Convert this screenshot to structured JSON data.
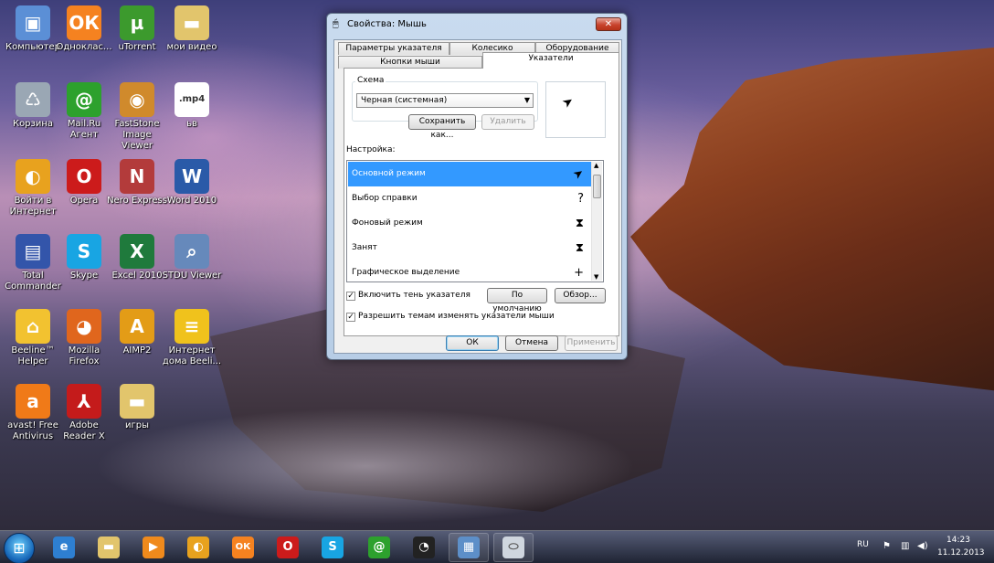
{
  "desktop": {
    "icons": [
      {
        "label": "Компьютер",
        "icon": "computer-icon",
        "color": "#5b8fd6",
        "glyph": "▣"
      },
      {
        "label": "Одноклас...",
        "icon": "odnoklassniki-icon",
        "color": "#f58220",
        "glyph": "ОК"
      },
      {
        "label": "uTorrent",
        "icon": "utorrent-icon",
        "color": "#3c9a2d",
        "glyph": "µ"
      },
      {
        "label": "мои видео",
        "icon": "folder-icon",
        "color": "#e2c56c",
        "glyph": "▬"
      },
      {
        "label": "Корзина",
        "icon": "recycle-bin-icon",
        "color": "#9aa7b4",
        "glyph": "♺"
      },
      {
        "label": "Mail.Ru Агент",
        "icon": "mailru-agent-icon",
        "color": "#2da12d",
        "glyph": "@"
      },
      {
        "label": "FastStone Image Viewer",
        "icon": "faststone-icon",
        "color": "#d08a2c",
        "glyph": "◉"
      },
      {
        "label": "ьв",
        "icon": "mp4-file-icon",
        "color": "#ffffff",
        "glyph": ".mp4"
      },
      {
        "label": "Войти в Интернет",
        "icon": "internet-icon",
        "color": "#e8a21e",
        "glyph": "◐"
      },
      {
        "label": "Opera",
        "icon": "opera-icon",
        "color": "#cc1b1b",
        "glyph": "O"
      },
      {
        "label": "Nero Express",
        "icon": "nero-icon",
        "color": "#b33b3b",
        "glyph": "N"
      },
      {
        "label": "Word 2010",
        "icon": "word-icon",
        "color": "#2a5aa8",
        "glyph": "W"
      },
      {
        "label": "Total Commander",
        "icon": "total-commander-icon",
        "color": "#3355aa",
        "glyph": "▤"
      },
      {
        "label": "Skype",
        "icon": "skype-icon",
        "color": "#18a5e3",
        "glyph": "S"
      },
      {
        "label": "Excel 2010",
        "icon": "excel-icon",
        "color": "#1f7a3c",
        "glyph": "X"
      },
      {
        "label": "STDU Viewer",
        "icon": "stdu-viewer-icon",
        "color": "#6689bb",
        "glyph": "⌕"
      },
      {
        "label": "Beeline™ Helper",
        "icon": "beeline-helper-icon",
        "color": "#f2c230",
        "glyph": "⌂"
      },
      {
        "label": "Mozilla Firefox",
        "icon": "firefox-icon",
        "color": "#e0661d",
        "glyph": "◕"
      },
      {
        "label": "AIMP2",
        "icon": "aimp-icon",
        "color": "#e39c17",
        "glyph": "A"
      },
      {
        "label": "Интернет дома Beeli...",
        "icon": "beeline-icon",
        "color": "#f0c21c",
        "glyph": "≡"
      },
      {
        "label": "avast! Free Antivirus",
        "icon": "avast-icon",
        "color": "#f07a18",
        "glyph": "a"
      },
      {
        "label": "Adobe Reader X",
        "icon": "adobe-reader-icon",
        "color": "#c41b1b",
        "glyph": "⅄"
      },
      {
        "label": "игры",
        "icon": "folder-icon",
        "color": "#e2c56c",
        "glyph": "▬"
      }
    ]
  },
  "dialog": {
    "title": "Свойства: Мышь",
    "close_label": "✕",
    "tabs_row1": [
      "Параметры указателя",
      "Колесико",
      "Оборудование"
    ],
    "tabs_row2": [
      "Кнопки мыши",
      "Указатели"
    ],
    "active_tab": "Указатели",
    "scheme_group_label": "Схема",
    "scheme_value": "Черная (системная)",
    "save_as_label": "Сохранить как...",
    "delete_label": "Удалить",
    "settings_label": "Настройка:",
    "pointer_rows": [
      {
        "label": "Основной режим",
        "cursor": "arrow-cursor-icon",
        "glyph": "➤",
        "selected": true
      },
      {
        "label": "Выбор справки",
        "cursor": "help-cursor-icon",
        "glyph": "?",
        "selected": false
      },
      {
        "label": "Фоновый режим",
        "cursor": "working-cursor-icon",
        "glyph": "⧗",
        "selected": false
      },
      {
        "label": "Занят",
        "cursor": "busy-cursor-icon",
        "glyph": "⧗",
        "selected": false
      },
      {
        "label": "Графическое выделение",
        "cursor": "crosshair-cursor-icon",
        "glyph": "+",
        "selected": false
      }
    ],
    "enable_shadow_label": "Включить тень указателя",
    "enable_shadow_checked": true,
    "default_label": "По умолчанию",
    "browse_label": "Обзор...",
    "allow_themes_label": "Разрешить темам изменять указатели мыши",
    "allow_themes_checked": true,
    "ok_label": "ОК",
    "cancel_label": "Отмена",
    "apply_label": "Применить"
  },
  "taskbar": {
    "start_label": "⊞",
    "items": [
      {
        "icon": "internet-explorer-icon",
        "color": "#2e7fd1",
        "glyph": "e"
      },
      {
        "icon": "explorer-folder-icon",
        "color": "#e2c56c",
        "glyph": "▬"
      },
      {
        "icon": "media-player-icon",
        "color": "#f08a1c",
        "glyph": "▶"
      },
      {
        "icon": "internet-icon",
        "color": "#e8a21e",
        "glyph": "◐"
      },
      {
        "icon": "odnoklassniki-icon",
        "color": "#f58220",
        "glyph": "ОК"
      },
      {
        "icon": "opera-icon",
        "color": "#cc1b1b",
        "glyph": "O"
      },
      {
        "icon": "skype-icon",
        "color": "#18a5e3",
        "glyph": "S"
      },
      {
        "icon": "mailru-agent-icon",
        "color": "#2da12d",
        "glyph": "@"
      },
      {
        "icon": "obs-icon",
        "color": "#222222",
        "glyph": "◔"
      },
      {
        "icon": "control-panel-icon",
        "color": "#5d8fc8",
        "glyph": "▦"
      },
      {
        "icon": "mouse-icon",
        "color": "#cfd6de",
        "glyph": "⬭"
      }
    ],
    "language": "RU",
    "time": "14:23",
    "date": "11.12.2013"
  }
}
